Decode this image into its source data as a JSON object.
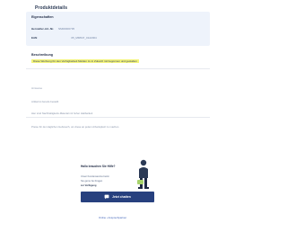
{
  "page": {
    "title": "Produktdetails"
  },
  "properties": {
    "heading": "Eigenschaften",
    "rows": [
      {
        "key": "Hersteller-Art.-Nr.",
        "value": "NM00000735"
      },
      {
        "key": "EAN",
        "value": "05_MM547_0122004"
      }
    ]
  },
  "description": {
    "heading": "Beschreibung",
    "text": "Diese Werbung für den Verfügbarkeit Melden zu in Zukunft mit begonnen und gestalten"
  },
  "notes": {
    "heading": "Hinweise",
    "items": [
      "Artikel ist bereits bestellt",
      "Hier sind Nachhaltigkeits-Material mit hoher Haltbarkeit",
      "Preise für den täglichen Gebrauch, um diese an jedem Arbeitsplatz zu machen."
    ]
  },
  "cta": {
    "heading": "Hallo brauchen Sie Hilfe?",
    "sub_lines": [
      "Unser Kundenservice berät",
      "Sie gerne bei Fragen",
      "zur Verfügung"
    ],
    "button_label": "Jetzt chatten",
    "button_icon": "chat-icon"
  },
  "footer": {
    "link_text": "Online • Ansprechpartner"
  },
  "colors": {
    "accent": "#27407e",
    "highlight": "#f3f47a",
    "card_bg": "#eef3fb",
    "link": "#3f63b8"
  }
}
